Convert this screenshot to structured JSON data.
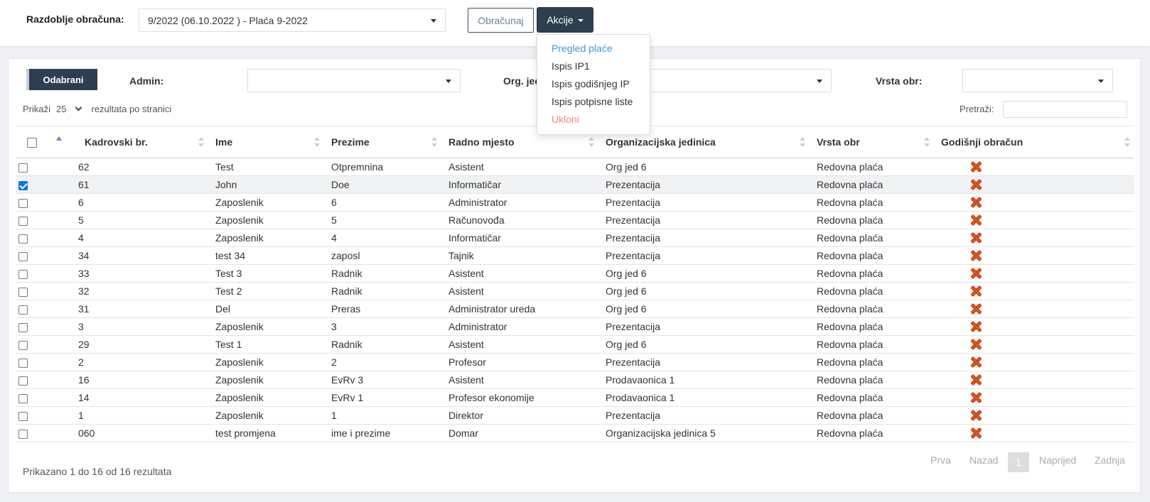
{
  "header": {
    "period_label": "Razdoblje obračuna:",
    "period_value": "9/2022 (06.10.2022 ) - Plaća 9-2022",
    "calc_button": "Obračunaj",
    "actions_button": "Akcije"
  },
  "actions_menu": {
    "items": [
      "Pregled plaće",
      "Ispis IP1",
      "Ispis godišnjeg IP",
      "Ispis potpisne liste",
      "Ukloni"
    ],
    "colors": {
      "link": "#3a9ad9",
      "danger": "#ef8a80"
    }
  },
  "filters": {
    "selected_button": "Odabrani",
    "admin_label": "Admin:",
    "admin_value": "",
    "org_label": "Org. jed",
    "org_value": "",
    "type_label": "Vrsta obr:",
    "type_value": ""
  },
  "list_controls": {
    "show_label": "Prikaži",
    "page_size": "25",
    "per_page_label": "rezultata po stranici",
    "search_label": "Pretraži:",
    "search_value": ""
  },
  "table": {
    "columns": [
      "Kadrovski br.",
      "Ime",
      "Prezime",
      "Radno mjesto",
      "Organizacijska jedinica",
      "Vrsta obr",
      "Godišnji obračun"
    ],
    "rows": [
      {
        "id": "62",
        "first": "Test",
        "last": "Otpremnina",
        "position": "Asistent",
        "unit": "Org jed 6",
        "type": "Redovna plaća",
        "checked": false
      },
      {
        "id": "61",
        "first": "John",
        "last": "Doe",
        "position": "Informatičar",
        "unit": "Prezentacija",
        "type": "Redovna plaća",
        "checked": true
      },
      {
        "id": "6",
        "first": "Zaposlenik",
        "last": "6",
        "position": "Administrator",
        "unit": "Prezentacija",
        "type": "Redovna plaća",
        "checked": false
      },
      {
        "id": "5",
        "first": "Zaposlenik",
        "last": "5",
        "position": "Računovođa",
        "unit": "Prezentacija",
        "type": "Redovna plaća",
        "checked": false
      },
      {
        "id": "4",
        "first": "Zaposlenik",
        "last": "4",
        "position": "Informatičar",
        "unit": "Prezentacija",
        "type": "Redovna plaća",
        "checked": false
      },
      {
        "id": "34",
        "first": "test 34",
        "last": "zaposl",
        "position": "Tajnik",
        "unit": "Prezentacija",
        "type": "Redovna plaća",
        "checked": false
      },
      {
        "id": "33",
        "first": "Test 3",
        "last": "Radnik",
        "position": "Asistent",
        "unit": "Org jed 6",
        "type": "Redovna plaća",
        "checked": false
      },
      {
        "id": "32",
        "first": "Test 2",
        "last": "Radnik",
        "position": "Asistent",
        "unit": "Org jed 6",
        "type": "Redovna plaća",
        "checked": false
      },
      {
        "id": "31",
        "first": "Del",
        "last": "Preras",
        "position": "Administrator ureda",
        "unit": "Org jed 6",
        "type": "Redovna plaća",
        "checked": false
      },
      {
        "id": "3",
        "first": "Zaposlenik",
        "last": "3",
        "position": "Administrator",
        "unit": "Prezentacija",
        "type": "Redovna plaća",
        "checked": false
      },
      {
        "id": "29",
        "first": "Test 1",
        "last": "Radnik",
        "position": "Asistent",
        "unit": "Org jed 6",
        "type": "Redovna plaća",
        "checked": false
      },
      {
        "id": "2",
        "first": "Zaposlenik",
        "last": "2",
        "position": "Profesor",
        "unit": "Prezentacija",
        "type": "Redovna plaća",
        "checked": false
      },
      {
        "id": "16",
        "first": "Zaposlenik",
        "last": "EvRv 3",
        "position": "Asistent",
        "unit": "Prodavaonica 1",
        "type": "Redovna plaća",
        "checked": false
      },
      {
        "id": "14",
        "first": "Zaposlenik",
        "last": "EvRv 1",
        "position": "Profesor ekonomije",
        "unit": "Prodavaonica 1",
        "type": "Redovna plaća",
        "checked": false
      },
      {
        "id": "1",
        "first": "Zaposlenik",
        "last": "1",
        "position": "Direktor",
        "unit": "Prezentacija",
        "type": "Redovna plaća",
        "checked": false
      },
      {
        "id": "060",
        "first": "test promjena",
        "last": "ime i prezime",
        "position": "Domar",
        "unit": "Organizacijska jedinica 5",
        "type": "Redovna plaća",
        "checked": false
      }
    ],
    "annual_icon": "x-icon"
  },
  "footer": {
    "info": "Prikazano 1 do 16 od 16 rezultata",
    "pager": {
      "first": "Prva",
      "prev": "Nazad",
      "current": "1",
      "next": "Naprijed",
      "last": "Zadnja"
    }
  }
}
